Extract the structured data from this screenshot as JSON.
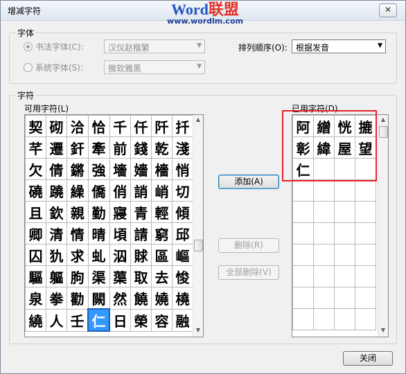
{
  "window": {
    "title": "增减字符",
    "close_glyph": "✕"
  },
  "watermark": {
    "line1_a": "Word",
    "line1_b": "联盟",
    "line2": "www.wordlm.com"
  },
  "font_group": {
    "label": "字体",
    "calligraphy_radio": "书法字体(C):",
    "calligraphy_value": "汉仪赵楷繁",
    "system_radio": "系统字体(S):",
    "system_value": "微软雅黑",
    "sort_label": "排列顺序(O):",
    "sort_value": "根据发音"
  },
  "chars_group": {
    "label": "字符",
    "available_label": "可用字符(L)",
    "used_label": "已用字符(D)",
    "available_rows": [
      [
        "契",
        "砌",
        "洽",
        "恰",
        "千",
        "仟",
        "阡",
        "扦"
      ],
      [
        "芊",
        "遷",
        "釬",
        "牽",
        "前",
        "錢",
        "乾",
        "淺"
      ],
      [
        "欠",
        "倩",
        "鏘",
        "強",
        "墻",
        "嬙",
        "檣",
        "悄"
      ],
      [
        "磽",
        "蹺",
        "繰",
        "僑",
        "俏",
        "誚",
        "峭",
        "切"
      ],
      [
        "且",
        "欽",
        "親",
        "勤",
        "寢",
        "青",
        "輕",
        "傾"
      ],
      [
        "卿",
        "清",
        "情",
        "晴",
        "頃",
        "請",
        "窮",
        "邱"
      ],
      [
        "囚",
        "犰",
        "求",
        "虬",
        "泅",
        "賕",
        "區",
        "嶇"
      ],
      [
        "驅",
        "軀",
        "朐",
        "渠",
        "蕖",
        "取",
        "去",
        "悛"
      ],
      [
        "泉",
        "拳",
        "勸",
        "闕",
        "然",
        "饒",
        "嬈",
        "橈"
      ],
      [
        "繞",
        "人",
        "壬",
        "仁",
        "日",
        "榮",
        "容",
        "融"
      ]
    ],
    "used_rows": [
      [
        "阿",
        "繒",
        "恍",
        "摝"
      ],
      [
        "彰",
        "緯",
        "屋",
        "望"
      ],
      [
        "仁",
        "",
        "",
        ""
      ],
      [
        "",
        "",
        "",
        ""
      ],
      [
        "",
        "",
        "",
        ""
      ],
      [
        "",
        "",
        "",
        ""
      ],
      [
        "",
        "",
        "",
        ""
      ],
      [
        "",
        "",
        "",
        ""
      ],
      [
        "",
        "",
        "",
        ""
      ],
      [
        "",
        "",
        "",
        ""
      ]
    ],
    "selected_char": "仁"
  },
  "buttons": {
    "add": "添加(A)",
    "delete": "删除(R)",
    "delete_all": "全部删除(V)",
    "close": "关闭"
  },
  "icons": {
    "scroll_up": "▲",
    "scroll_down": "▼",
    "dropdown": "▼"
  }
}
